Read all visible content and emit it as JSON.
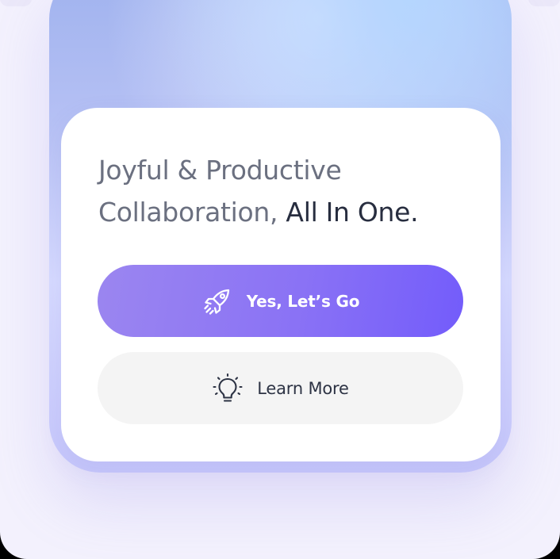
{
  "hero": {
    "headline_part1": "Joyful & Productive",
    "headline_part2": "Collaboration, ",
    "headline_strong": "All In One."
  },
  "actions": {
    "primary": {
      "label": "Yes, Let’s Go",
      "icon": "rocket-icon"
    },
    "secondary": {
      "label": "Learn More",
      "icon": "lightbulb-icon"
    }
  },
  "colors": {
    "primary_button": "#8a72f5",
    "secondary_button": "#f4f4f4",
    "headline_text": "#6b7080",
    "headline_strong_text": "#272d3f"
  }
}
